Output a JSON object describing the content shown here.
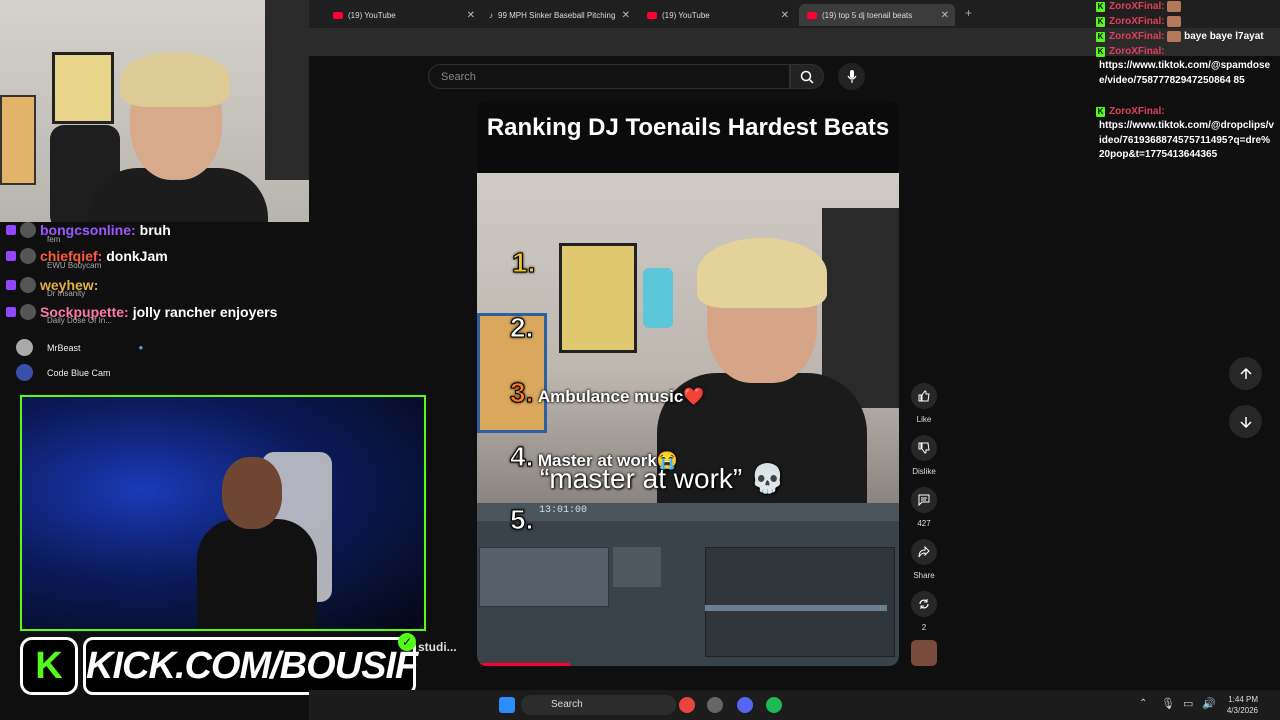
{
  "browser": {
    "tabs": [
      {
        "label": "(19) YouTube"
      },
      {
        "label": "99 MPH Sinker Baseball Pitching"
      },
      {
        "label": "(19) YouTube"
      },
      {
        "label": "(19) top 5 dj toenail beats"
      }
    ]
  },
  "youtube": {
    "search_placeholder": "Search",
    "short": {
      "title": "Ranking DJ Toenails Hardest Beats",
      "ranks": [
        {
          "num": "1.",
          "text": ""
        },
        {
          "num": "2.",
          "text": ""
        },
        {
          "num": "3.",
          "text": "Ambulance music❤️"
        },
        {
          "num": "4.",
          "text": "Master at work😭"
        },
        {
          "num": "5.",
          "text": ""
        }
      ],
      "caption": "“master at work” 💀",
      "daw_time": "13:01:00",
      "progress": 0.22
    },
    "actions": {
      "like": "Like",
      "dislike": "Dislike",
      "comments": "427",
      "share": "Share",
      "remix": "2"
    }
  },
  "left_chat": {
    "lines": [
      {
        "user": "bongcsonline:",
        "msg": "bruh",
        "color": "#9b59ff",
        "sub": "fem"
      },
      {
        "user": "chiefqief:",
        "msg": "donkJam",
        "color": "#ff5a3c",
        "sub": "EWU Bouycam"
      },
      {
        "user": "weyhew:",
        "msg": "",
        "color": "#e0b23a",
        "sub": "Dr Insanity"
      },
      {
        "user": "Sockpupette:",
        "msg": "jolly rancher enjoyers",
        "color": "#ff7aa2",
        "sub": "Daily Dose Of In..."
      }
    ],
    "sidebar": [
      {
        "name": "MrBeast"
      },
      {
        "name": "Code Blue Cam"
      }
    ]
  },
  "kick": {
    "logo": "K",
    "url": "KICK.COM/BOUSIF",
    "studio": "studi..."
  },
  "right_chat": {
    "user": "ZoroXFinal:",
    "msg1": "baye baye l7ayat",
    "link1": "https://www.tiktok.com/@spamdosee/video/75877782947250864 85",
    "link2": "https://www.tiktok.com/@dropclips/video/7619368874575711495?q=dre%20pop&t=1775413644365"
  },
  "taskbar": {
    "search": "Search",
    "time": "1:44 PM",
    "date": "4/3/2026"
  },
  "colors": {
    "kick_green": "#53fc18",
    "youtube_red": "#ff0033"
  }
}
